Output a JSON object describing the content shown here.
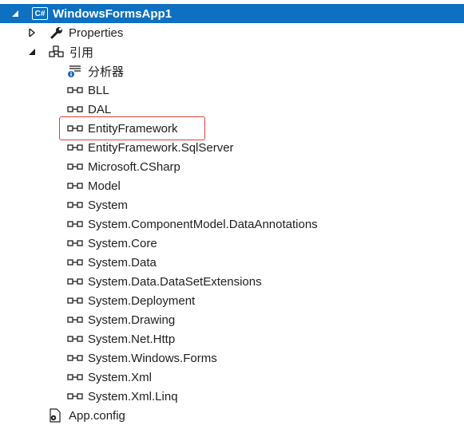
{
  "project": {
    "name": "WindowsFormsApp1",
    "badge": "C#"
  },
  "properties": {
    "label": "Properties"
  },
  "references": {
    "label": "引用",
    "analyzers": "分析器",
    "items": [
      "BLL",
      "DAL",
      "EntityFramework",
      "EntityFramework.SqlServer",
      "Microsoft.CSharp",
      "Model",
      "System",
      "System.ComponentModel.DataAnnotations",
      "System.Core",
      "System.Data",
      "System.Data.DataSetExtensions",
      "System.Deployment",
      "System.Drawing",
      "System.Net.Http",
      "System.Windows.Forms",
      "System.Xml",
      "System.Xml.Linq"
    ]
  },
  "appconfig": {
    "label": "App.config"
  },
  "colors": {
    "selection": "#0e70c0",
    "highlight_border": "#e0403a"
  }
}
